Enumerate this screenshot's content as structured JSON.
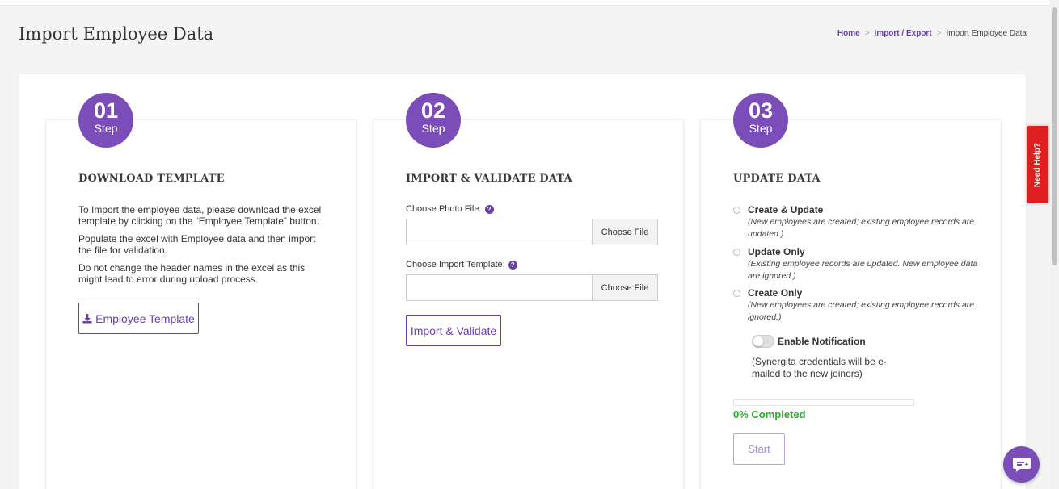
{
  "page": {
    "title": "Import Employee Data"
  },
  "breadcrumb": {
    "home": "Home",
    "sep1": ">",
    "import_export": "Import / Export",
    "sep2": ">",
    "current": "Import Employee Data"
  },
  "steps": [
    {
      "number": "01",
      "step_label": "Step",
      "title": "DOWNLOAD TEMPLATE",
      "paragraphs": [
        "To Import the employee data, please download the excel template by clicking on the “Employee Template” button.",
        "Populate the excel with Employee data and then import the file for validation.",
        "Do not change the header names in the excel as this might lead to error during upload process."
      ],
      "button": {
        "label": "Employee Template",
        "icon": "download-icon"
      }
    },
    {
      "number": "02",
      "step_label": "Step",
      "title": "IMPORT & VALIDATE DATA",
      "photo_file": {
        "label": "Choose Photo File:",
        "value": "",
        "button": "Choose File"
      },
      "import_template": {
        "label": "Choose Import Template:",
        "value": "",
        "button": "Choose File"
      },
      "help_icon": "?",
      "button": {
        "label": "Import & Validate"
      }
    },
    {
      "number": "03",
      "step_label": "Step",
      "title": "UPDATE DATA",
      "options": [
        {
          "label": "Create & Update",
          "desc": "(New employees are created; existing employee records are updated.)",
          "selected": false
        },
        {
          "label": "Update Only",
          "desc": "(Existing employee records are updated. New employee data are ignored.)",
          "selected": false
        },
        {
          "label": "Create Only",
          "desc": "(New employees are created; existing employee records are ignored.)",
          "selected": false
        }
      ],
      "notification": {
        "label": "Enable Notification",
        "enabled": false,
        "note": "(Synergita credentials will be e-mailed to the new joiners)"
      },
      "progress": {
        "percent": 0,
        "label": "0% Completed"
      },
      "button": {
        "label": "Start"
      }
    }
  ],
  "need_help": {
    "label": "Need Help?"
  },
  "colors": {
    "accent": "#7b4db8",
    "link": "#6a3fa8",
    "success": "#2fa830",
    "help": "#e02020"
  }
}
